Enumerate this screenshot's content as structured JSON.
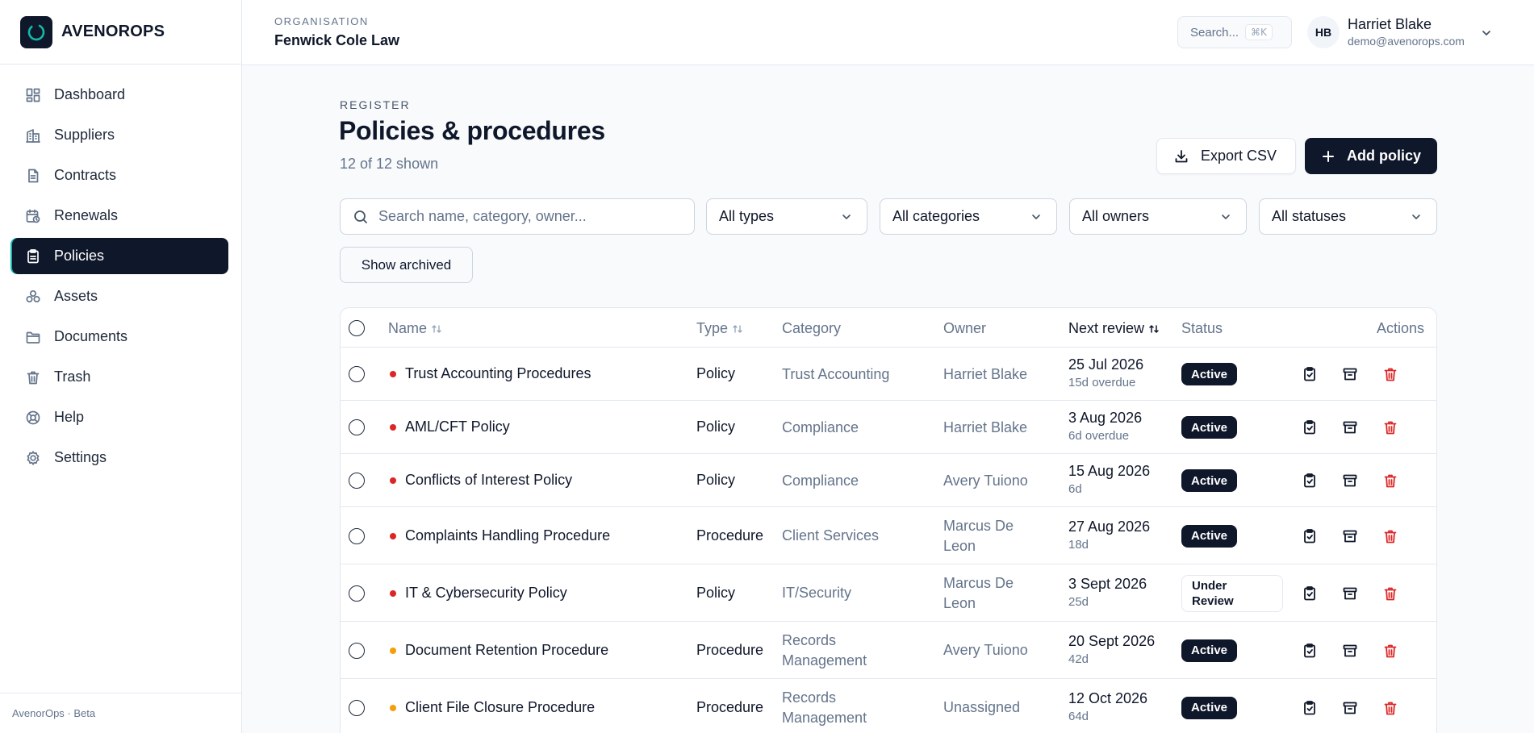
{
  "brand": {
    "name": "AVENOROPS"
  },
  "nav": [
    {
      "label": "Dashboard",
      "icon": "dashboard-icon"
    },
    {
      "label": "Suppliers",
      "icon": "building-icon"
    },
    {
      "label": "Contracts",
      "icon": "file-icon"
    },
    {
      "label": "Renewals",
      "icon": "calendar-clock-icon"
    },
    {
      "label": "Policies",
      "icon": "clipboard-icon",
      "active": true
    },
    {
      "label": "Assets",
      "icon": "boxes-icon"
    },
    {
      "label": "Documents",
      "icon": "folder-icon"
    },
    {
      "label": "Trash",
      "icon": "trash-icon"
    },
    {
      "label": "Help",
      "icon": "lifebuoy-icon"
    },
    {
      "label": "Settings",
      "icon": "gear-icon"
    }
  ],
  "footer": "AvenorOps · Beta",
  "header": {
    "org_label": "ORGANISATION",
    "org_name": "Fenwick Cole Law",
    "search_label": "Search...",
    "search_shortcut": "⌘K",
    "user_initials": "HB",
    "user_name": "Harriet Blake",
    "user_email": "demo@avenorops.com"
  },
  "page": {
    "eyebrow": "REGISTER",
    "title": "Policies & procedures",
    "subtitle": "12 of 12 shown",
    "export_label": "Export CSV",
    "add_label": "Add policy",
    "search_placeholder": "Search name, category, owner...",
    "filters": {
      "type": "All types",
      "category": "All categories",
      "owner": "All owners",
      "status": "All statuses"
    },
    "archived_label": "Show archived"
  },
  "table": {
    "columns": {
      "name": "Name",
      "type": "Type",
      "category": "Category",
      "owner": "Owner",
      "next_review": "Next review",
      "status": "Status",
      "actions": "Actions"
    },
    "rows": [
      {
        "name": "Trust Accounting Procedures",
        "type": "Policy",
        "category": [
          "Trust Accounting"
        ],
        "owner": [
          "Harriet Blake"
        ],
        "date": "25 Jul 2026",
        "due": "15d overdue",
        "status": [
          "Active"
        ],
        "priority_color": "#dc2626"
      },
      {
        "name": "AML/CFT Policy",
        "type": "Policy",
        "category": [
          "Compliance"
        ],
        "owner": [
          "Harriet Blake"
        ],
        "date": "3 Aug 2026",
        "due": "6d overdue",
        "status": [
          "Active"
        ],
        "priority_color": "#dc2626"
      },
      {
        "name": "Conflicts of Interest Policy",
        "type": "Policy",
        "category": [
          "Compliance"
        ],
        "owner": [
          "Avery Tuiono"
        ],
        "date": "15 Aug 2026",
        "due": "6d",
        "status": [
          "Active"
        ],
        "priority_color": "#dc2626"
      },
      {
        "name": "Complaints Handling Procedure",
        "type": "Procedure",
        "category": [
          "Client Services"
        ],
        "owner": [
          "Marcus De",
          "Leon"
        ],
        "date": "27 Aug 2026",
        "due": "18d",
        "status": [
          "Active"
        ],
        "priority_color": "#dc2626"
      },
      {
        "name": "IT & Cybersecurity Policy",
        "type": "Policy",
        "category": [
          "IT/Security"
        ],
        "owner": [
          "Marcus De",
          "Leon"
        ],
        "date": "3 Sept 2026",
        "due": "25d",
        "status": [
          "Under",
          "Review"
        ],
        "priority_color": "#dc2626"
      },
      {
        "name": "Document Retention Procedure",
        "type": "Procedure",
        "category": [
          "Records",
          "Management"
        ],
        "owner": [
          "Avery Tuiono"
        ],
        "date": "20 Sept 2026",
        "due": "42d",
        "status": [
          "Active"
        ],
        "priority_color": "#f59e0b"
      },
      {
        "name": "Client File Closure Procedure",
        "type": "Procedure",
        "category": [
          "Records",
          "Management"
        ],
        "owner": [
          "Unassigned"
        ],
        "date": "12 Oct 2026",
        "due": "64d",
        "status": [
          "Active"
        ],
        "priority_color": "#f59e0b"
      }
    ]
  },
  "colors": {
    "primary": "#0f172a",
    "accent": "#14b8a6",
    "danger": "#dc2626",
    "warning": "#f59e0b",
    "muted": "#64748b"
  }
}
